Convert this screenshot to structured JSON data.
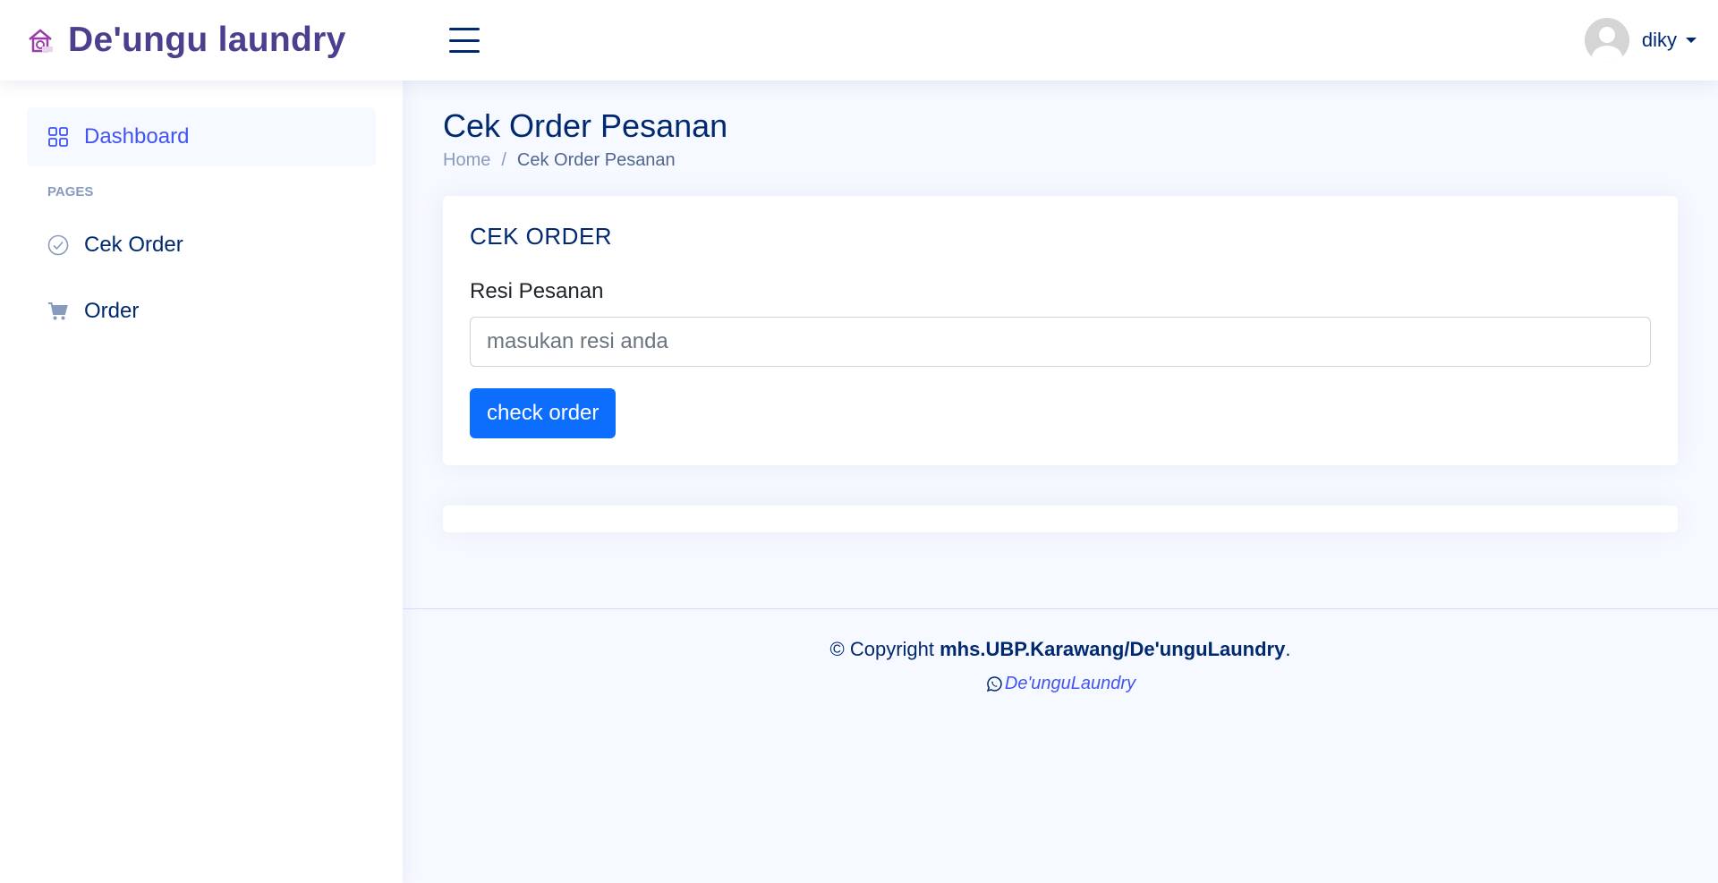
{
  "header": {
    "brand": "De'ungu laundry",
    "user_name": "diky"
  },
  "sidebar": {
    "dashboard_label": "Dashboard",
    "section_heading": "PAGES",
    "items": [
      {
        "label": "Cek Order",
        "icon": "check-circle-icon"
      },
      {
        "label": "Order",
        "icon": "cart-icon"
      }
    ]
  },
  "page": {
    "title": "Cek Order Pesanan",
    "breadcrumb": {
      "home": "Home",
      "separator": "/",
      "current": "Cek Order Pesanan"
    }
  },
  "card": {
    "title": "CEK ORDER",
    "field_label": "Resi Pesanan",
    "field_placeholder": "masukan resi anda",
    "field_value": "",
    "button_label": "check order"
  },
  "footer": {
    "copyright_prefix": "© Copyright",
    "copyright_owner": "mhs.UBP.Karawang/De'unguLaundry",
    "copyright_suffix": ".",
    "credit_link": "De'unguLaundry"
  },
  "colors": {
    "brand": "#4b3f8e",
    "primary": "#0d6efd",
    "nav_active": "#4154f1",
    "text_dark": "#012970",
    "background": "#f6f9ff"
  }
}
